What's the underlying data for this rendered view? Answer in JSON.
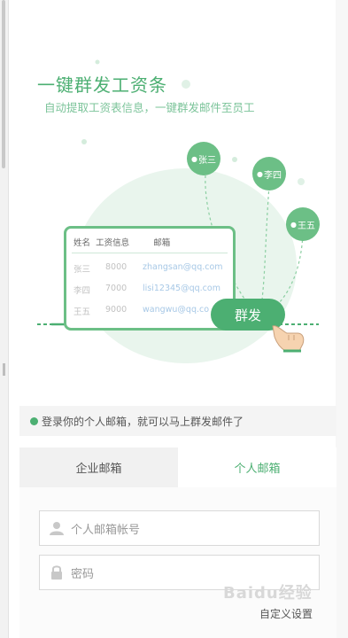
{
  "hero": {
    "title": "一键群发工资条",
    "subtitle": "自动提取工资表信息，一键群发邮件至员工"
  },
  "recipients": [
    {
      "name": "张三"
    },
    {
      "name": "李四"
    },
    {
      "name": "王五"
    }
  ],
  "table": {
    "headers": [
      "姓名",
      "工资信息",
      "邮箱"
    ],
    "rows": [
      [
        "张三",
        "8000",
        "zhangsan@qq.com"
      ],
      [
        "李四",
        "7000",
        "lisi12345@qq.com"
      ],
      [
        "王五",
        "9000",
        "wangwu@qq.co"
      ]
    ]
  },
  "send_button": "群发",
  "notice": "登录你的个人邮箱，就可以马上群发邮件了",
  "tabs": [
    {
      "label": "企业邮箱",
      "active": false
    },
    {
      "label": "个人邮箱",
      "active": true
    }
  ],
  "form": {
    "account_placeholder": "个人邮箱帐号",
    "password_placeholder": "密码",
    "custom_settings": "自定义设置"
  },
  "watermark": "Baidu经验",
  "colors": {
    "accent": "#4caf72",
    "accent_light": "#6cbf86"
  }
}
